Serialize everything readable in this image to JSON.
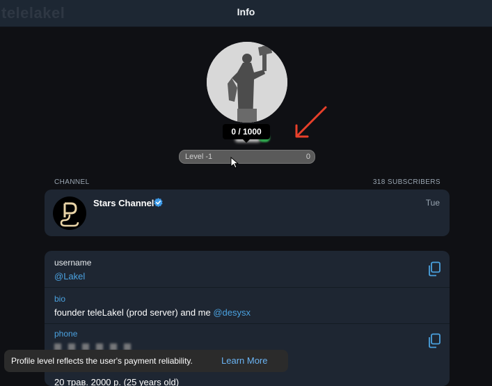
{
  "header": {
    "title": "Info",
    "watermark": "telelakel"
  },
  "profile": {
    "progress_tooltip": "0 / 1000",
    "level_label": "Level -1",
    "level_value": "0",
    "level_fraction": 0
  },
  "channel": {
    "section_label": "CHANNEL",
    "subscribers": "318 SUBSCRIBERS",
    "name": "Stars Channel",
    "time": "Tue"
  },
  "info": {
    "username_label": "username",
    "username_value": "@Lakel",
    "bio_label": "bio",
    "bio_text": "founder teleLakel (prod server) and me ",
    "bio_mention": "@desysx",
    "phone_label": "phone",
    "birthday_value": "20 трав. 2000 р. (25 years old)"
  },
  "toast": {
    "text": "Profile level reflects the user's payment reliability.",
    "link": "Learn More"
  },
  "colors": {
    "accent": "#4ba2e0",
    "card": "#1e2632",
    "background": "#0f1014",
    "arrow": "#e8402a"
  }
}
